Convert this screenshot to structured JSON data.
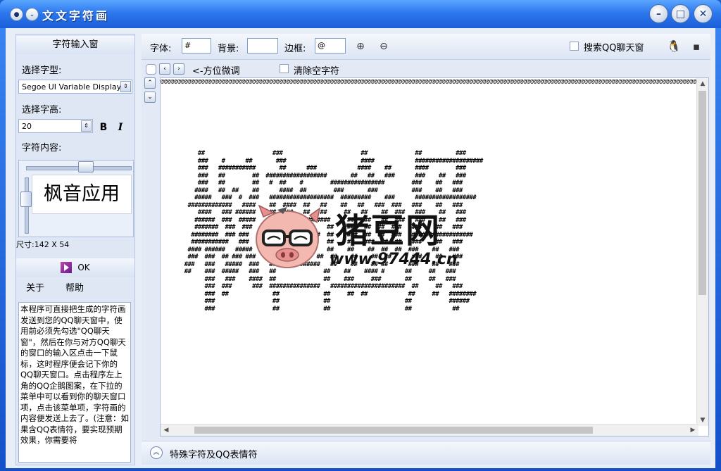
{
  "window": {
    "title": "文文字符画"
  },
  "left_panel": {
    "header": "字符输入窗",
    "font_type_label": "选择字型:",
    "font_type_value": "Segoe UI Variable Display",
    "font_size_label": "选择字高:",
    "font_size_value": "20",
    "bold_label": "B",
    "italic_label": "I",
    "content_label": "字符内容:",
    "preview_text": "枫音应用",
    "size_label": "尺寸:142 X 54",
    "ok_label": "OK",
    "about_label": "关于",
    "help_label": "帮助",
    "help_text": "本程序可直接把生成的字符画发送到您的QQ聊天窗中，使用前必须先勾选\"QQ聊天窗\"，然后在你与对方QQ聊天的窗口的输入区点击一下鼠标，这时程序便会记下你的QQ聊天窗口。点击程序左上角的QQ企鹅图案，在下拉的菜单中可以看到你的聊天窗口项，点击该菜单项，字符画的内容便发送上去了。(注意：如果含QQ表情符，要实现预期效果，你需要将"
  },
  "toolbar": {
    "font_label": "字体:",
    "font_value": "#",
    "bg_label": "背景:",
    "bg_value": "",
    "border_label": "边框:",
    "border_value": "@",
    "search_qq_label": "搜索QQ聊天窗",
    "fine_tune_label": "<-方位微调",
    "clear_blank_label": "清除空字符"
  },
  "canvas": {
    "top_border": "@@@@@@@@@@@@@@@@@@@@@@@@@@@@@@@@@@@@@@@@@@@@@@@@@@@@@@@@@@@@@@@@@@@@@@@@@@@@@@@@@@@@@@@@@@@@@@@@@@@@@@@@@@@@@@@@@@@@@@@@@@@@@@@@@@@@@@@@@@@@@@@@@@@@@@@@@@@@@@@@@@@@@@@@@@@@@@@@@@@@@@",
    "ascii_art": "      ##                    ###                       ##              ##          ###\n      ###    #      ##       ###                      ####            ####################\n      ###   ###########       ##      ###            ####    ##       ####        ###\n      ###   ##        ##  ##################       ##   ##   ###      ###    ##   ###\n      ###   ##        ##   #  ##    #        ################        ###    ##   ###\n     ####   ##  ##    ##      ####  ##        ###       ###          ###    ##   ###\n     #####   ###  #  ###   ###################  #########    ###      ##################\n   #############   ####    ##  ####  ##   ##    ##   ##   ###  ###   ###    ##   ###\n      ####   ### ######    ##  ###   ##   ##     ##   ##    ##  ###   ###    ##   ###\n     ######  ###  #####    ##################     ##   ##   ##  ###   ###    ##   ###\n     #######  ###  ###     ##               ##    ##   ##  ##  ###   ###    ##   ###\n    ########  ### ###      ###############  ##    ###  ##  ##  ###   ##################\n    ###########   ###      ##               ##    ##   ###  ##  ##   ###    ##   ###\n   #### ######   #####     ##############   ##    ##    ##  ##  ##  ###    ##   ###\n   ###  ###  ## ### ###    ##            ##  ##    ##    ##  ##      ###    ##   ###\n  ###   ###   #####  ###   ###############   ##    ##    ## ##      ###    ##   ###\n  ##    ###  #####   ###   ##              ##    ##    #### #      ##     ##   ###\n        ###   ###    ####  ##              ##    ###     ###       ##     ##   ###\n        ###  ###      ###  ###############   ######################  ##     ##   ###\n        ###  ##             ##             ##     ##  ##            ##     ##   ########\n        ###                 ##             ##                      ##           ######\n        ###                 ##             ##                      ##            ##",
    "watermark_text": "猪豆网",
    "watermark_url": "www.97444.cn"
  },
  "bottom": {
    "special_chars_label": "特殊字符及QQ表情符"
  }
}
